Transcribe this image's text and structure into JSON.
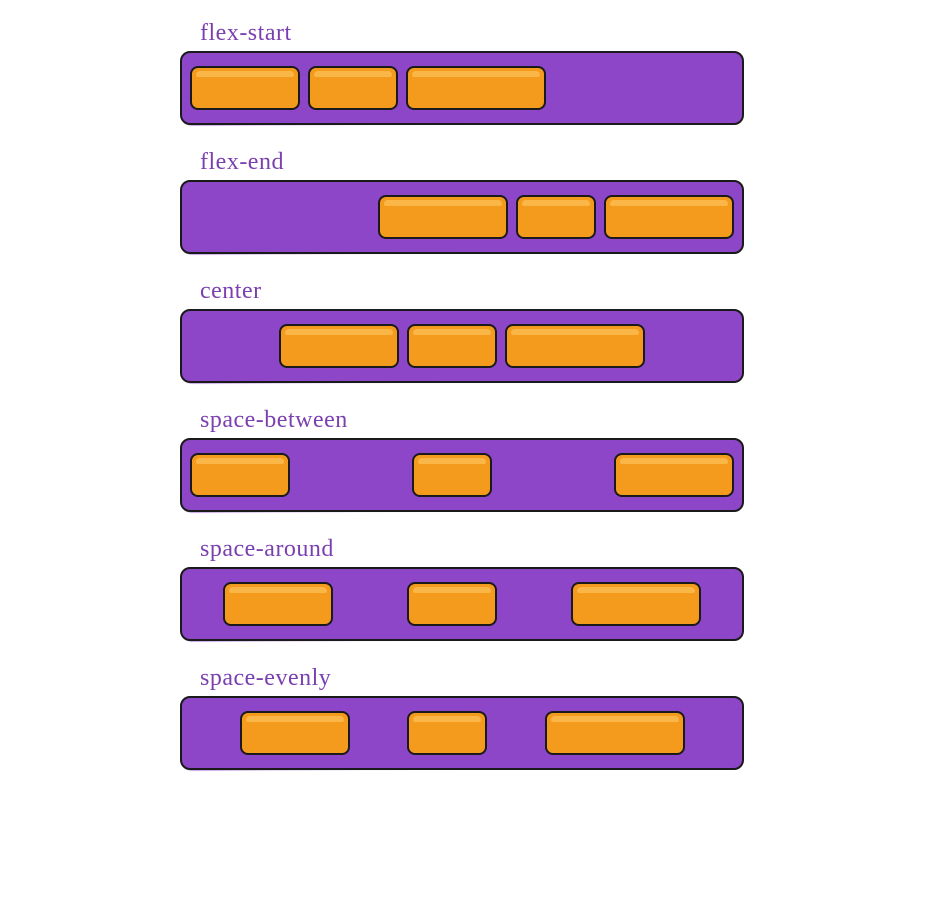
{
  "colors": {
    "container": "#8d46c8",
    "box": "#f49b1e",
    "outline": "#1a1a1a",
    "label": "#7a3fb0"
  },
  "examples": [
    {
      "label": "flex-start",
      "justify": "flex-start",
      "boxes": [
        110,
        90,
        140
      ]
    },
    {
      "label": "flex-end",
      "justify": "flex-end",
      "boxes": [
        130,
        80,
        130
      ]
    },
    {
      "label": "center",
      "justify": "center",
      "boxes": [
        120,
        90,
        140
      ]
    },
    {
      "label": "space-between",
      "justify": "space-between",
      "boxes": [
        100,
        80,
        120
      ]
    },
    {
      "label": "space-around",
      "justify": "space-around",
      "boxes": [
        110,
        90,
        130
      ]
    },
    {
      "label": "space-evenly",
      "justify": "space-evenly",
      "boxes": [
        110,
        80,
        140
      ]
    }
  ]
}
